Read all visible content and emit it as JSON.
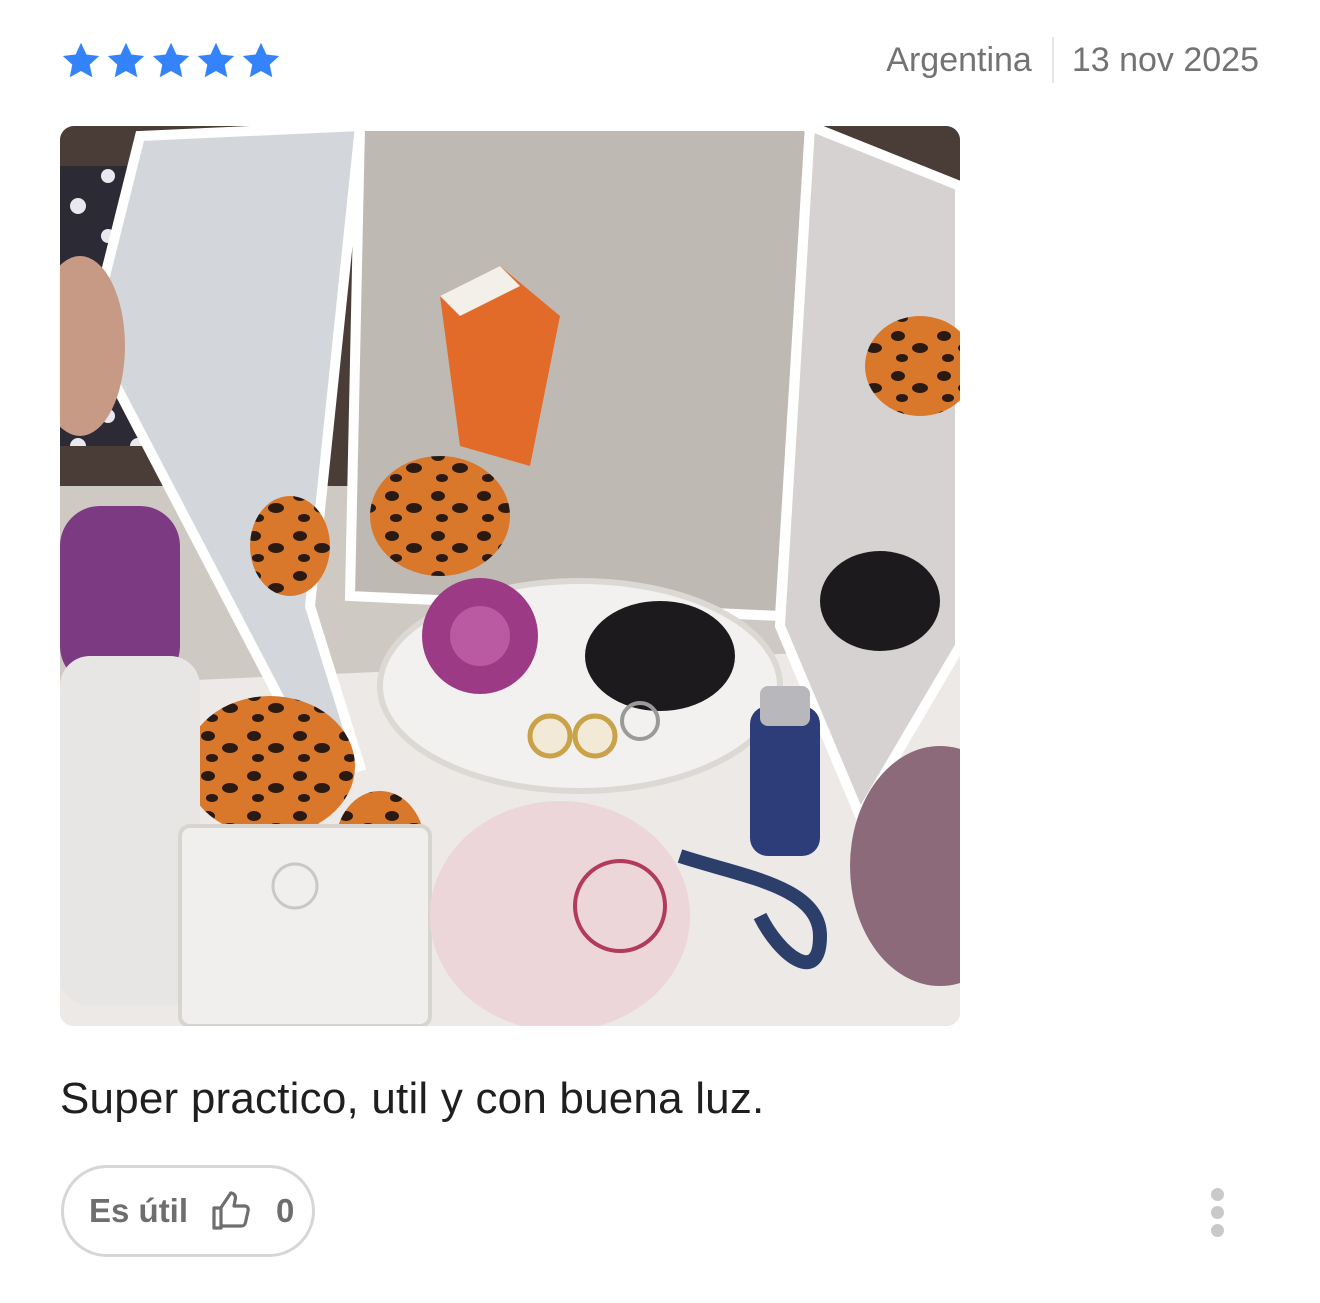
{
  "review": {
    "rating": {
      "value": 5,
      "max": 5,
      "star_color": "#3483fa"
    },
    "country": "Argentina",
    "date": "13 nov 2025",
    "photo": {
      "kind": "user-photo"
    },
    "text": "Super practico, util y con buena luz.",
    "helpful": {
      "label": "Es útil",
      "count": "0",
      "icon": "thumbs-up-icon"
    },
    "more_icon": "more-vertical-icon"
  }
}
